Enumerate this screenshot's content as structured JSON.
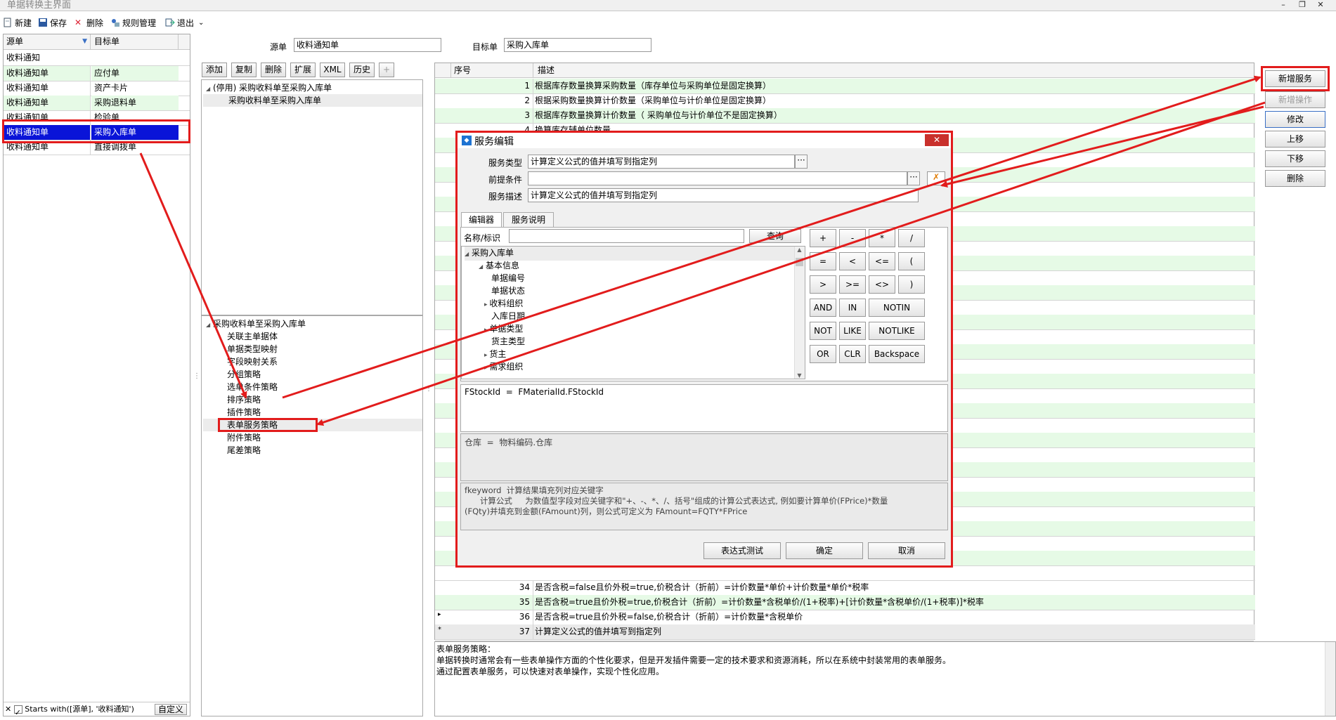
{
  "window": {
    "title": "单据转换主界面"
  },
  "toolbar": {
    "new": "新建",
    "save": "保存",
    "delete": "删除",
    "rules": "规则管理",
    "exit": "退出"
  },
  "left_grid": {
    "col_source": "源单",
    "col_target": "目标单",
    "filter_value": "收料通知",
    "rows": [
      {
        "source": "收料通知单",
        "target": "应付单"
      },
      {
        "source": "收料通知单",
        "target": "资产卡片"
      },
      {
        "source": "收料通知单",
        "target": "采购退料单"
      },
      {
        "source": "收料通知单",
        "target": "检验单"
      },
      {
        "source": "收料通知单",
        "target": "采购入库单"
      },
      {
        "source": "收料通知单",
        "target": "直接调拨单"
      }
    ],
    "footer_filter": "Starts with([源单], '收料通知')",
    "footer_btn": "自定义"
  },
  "top_fields": {
    "source_label": "源单",
    "source_value": "收料通知单",
    "target_label": "目标单",
    "target_value": "采购入库单"
  },
  "middle_tabs": {
    "add": "添加",
    "copy": "复制",
    "delete": "删除",
    "extend": "扩展",
    "xml": "XML",
    "history": "历史",
    "plus": "+"
  },
  "middle_tree_top": {
    "root": "(停用) 采购收料单至采购入库单",
    "child": "采购收料单至采购入库单"
  },
  "middle_tree_bottom": {
    "root": "采购收料单至采购入库单",
    "items": [
      "关联主单据体",
      "单据类型映射",
      "字段映射关系",
      "分组策略",
      "选单条件策略",
      "排序策略",
      "插件策略",
      "表单服务策略",
      "附件策略",
      "尾差策略"
    ]
  },
  "right_grid": {
    "col_seq": "序号",
    "col_desc": "描述",
    "rows": [
      {
        "seq": "1",
        "desc": "根据库存数量换算采购数量（库存单位与采购单位是固定换算）"
      },
      {
        "seq": "2",
        "desc": "根据采购数量换算计价数量（采购单位与计价单位是固定换算）"
      },
      {
        "seq": "3",
        "desc": "根据库存数量换算计价数量（ 采购单位与计价单位不是固定换算）"
      },
      {
        "seq": "4",
        "desc": "换算库存辅单位数量"
      }
    ],
    "bottom_rows": [
      {
        "seq": "34",
        "desc": "是否含税=false且价外税=true,价税合计（折前）=计价数量*单价+计价数量*单价*税率"
      },
      {
        "seq": "35",
        "desc": "是否含税=true且价外税=true,价税合计（折前）=计价数量*含税单价/(1+税率)+[计价数量*含税单价/(1+税率)]*税率"
      },
      {
        "seq": "36",
        "desc": "是否含税=true且价外税=false,价税合计（折前）=计价数量*含税单价"
      },
      {
        "seq": "37",
        "desc": "计算定义公式的值并填写到指定列"
      }
    ]
  },
  "right_buttons": {
    "add_service": "新增服务",
    "add_op": "新增操作",
    "modify": "修改",
    "up": "上移",
    "down": "下移",
    "delete": "删除"
  },
  "info_panel": {
    "title": "表单服务策略：",
    "line1": "单据转换时通常会有一些表单操作方面的个性化要求，但是开发插件需要一定的技术要求和资源消耗，所以在系统中封装常用的表单服务。",
    "line2": "通过配置表单服务，可以快速对表单操作，实现个性化应用。"
  },
  "dialog": {
    "title": "服务编辑",
    "service_type_label": "服务类型",
    "service_type_value": "计算定义公式的值并填写到指定列",
    "precond_label": "前提条件",
    "precond_value": "",
    "desc_label": "服务描述",
    "desc_value": "计算定义公式的值并填写到指定列",
    "tab_editor": "编辑器",
    "tab_help": "服务说明",
    "name_label": "名称/标识",
    "query_btn": "查询",
    "tree": {
      "root": "采购入库单",
      "group": "基本信息",
      "items": [
        "单据编号",
        "单据状态",
        "收料组织",
        "入库日期",
        "单据类型",
        "货主类型",
        "货主",
        "需求组织"
      ]
    },
    "ops": [
      "+",
      "-",
      "*",
      "/",
      "=",
      "<",
      "<=",
      "(",
      ">",
      ">=",
      "<>",
      ")",
      "AND",
      "IN",
      "NOTIN",
      "NOT",
      "LIKE",
      "NOTLIKE",
      "OR",
      "CLR",
      "Backspace"
    ],
    "formula_code": "FStockId  =  FMaterialId.FStockId",
    "formula_name": "仓库  =  物料编码.仓库",
    "help_text": "fkeyword  计算结果填充列对应关键字\n      计算公式     为数值型字段对应关键字和\"+、-、*、/、括号\"组成的计算公式表达式, 例如要计算单价(FPrice)*数量\n(FQty)并填充到金额(FAmount)列，则公式可定义为 FAmount=FQTY*FPrice",
    "test_btn": "表达式测试",
    "ok_btn": "确定",
    "cancel_btn": "取消"
  },
  "colors": {
    "red": "#e21c1c",
    "green_row": "#e6fae6",
    "select_blue": "#0a14d8"
  }
}
